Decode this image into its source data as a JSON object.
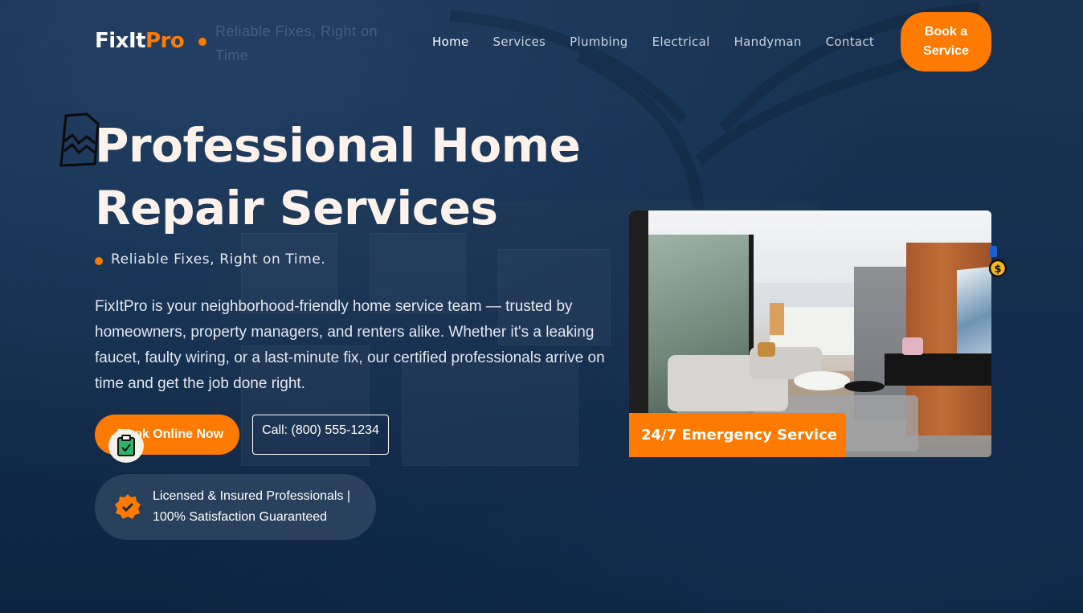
{
  "brand": {
    "name_main": "FixIt",
    "name_accent": "Pro",
    "accent_color": "#ff7a00"
  },
  "ghost_tagline": "Reliable Fixes, Right on Time",
  "nav": {
    "items": [
      {
        "label": "Home",
        "active": true
      },
      {
        "label": "Services",
        "active": false
      },
      {
        "label": "Plumbing",
        "active": false
      },
      {
        "label": "Electrical",
        "active": false
      },
      {
        "label": "Handyman",
        "active": false
      },
      {
        "label": "Contact",
        "active": false
      }
    ],
    "cta": "Book a Service"
  },
  "hero": {
    "title": "Professional Home Repair Services",
    "tagline": "Reliable Fixes, Right on Time.",
    "description_brand": "FixItPro",
    "description": " is your neighborhood-friendly home service team — trusted by homeowners, property managers, and renters alike. Whether it's a leaking faucet, faulty wiring, or a last-minute fix, our certified professionals arrive on time and get the job done right.",
    "primary_button": "Book Online Now",
    "secondary_button": "Call: (800) 555-1234",
    "trust_text": "Licensed & Insured Professionals | 100% Satisfaction Guaranteed"
  },
  "card": {
    "image_icon": "living-room-photo",
    "badge": "24/7 Emergency Service"
  },
  "icons": {
    "doc": "document-chart-icon",
    "clipboard": "clipboard-check-icon",
    "trust": "verified-badge-icon",
    "coin": "dollar-coin-icon"
  }
}
